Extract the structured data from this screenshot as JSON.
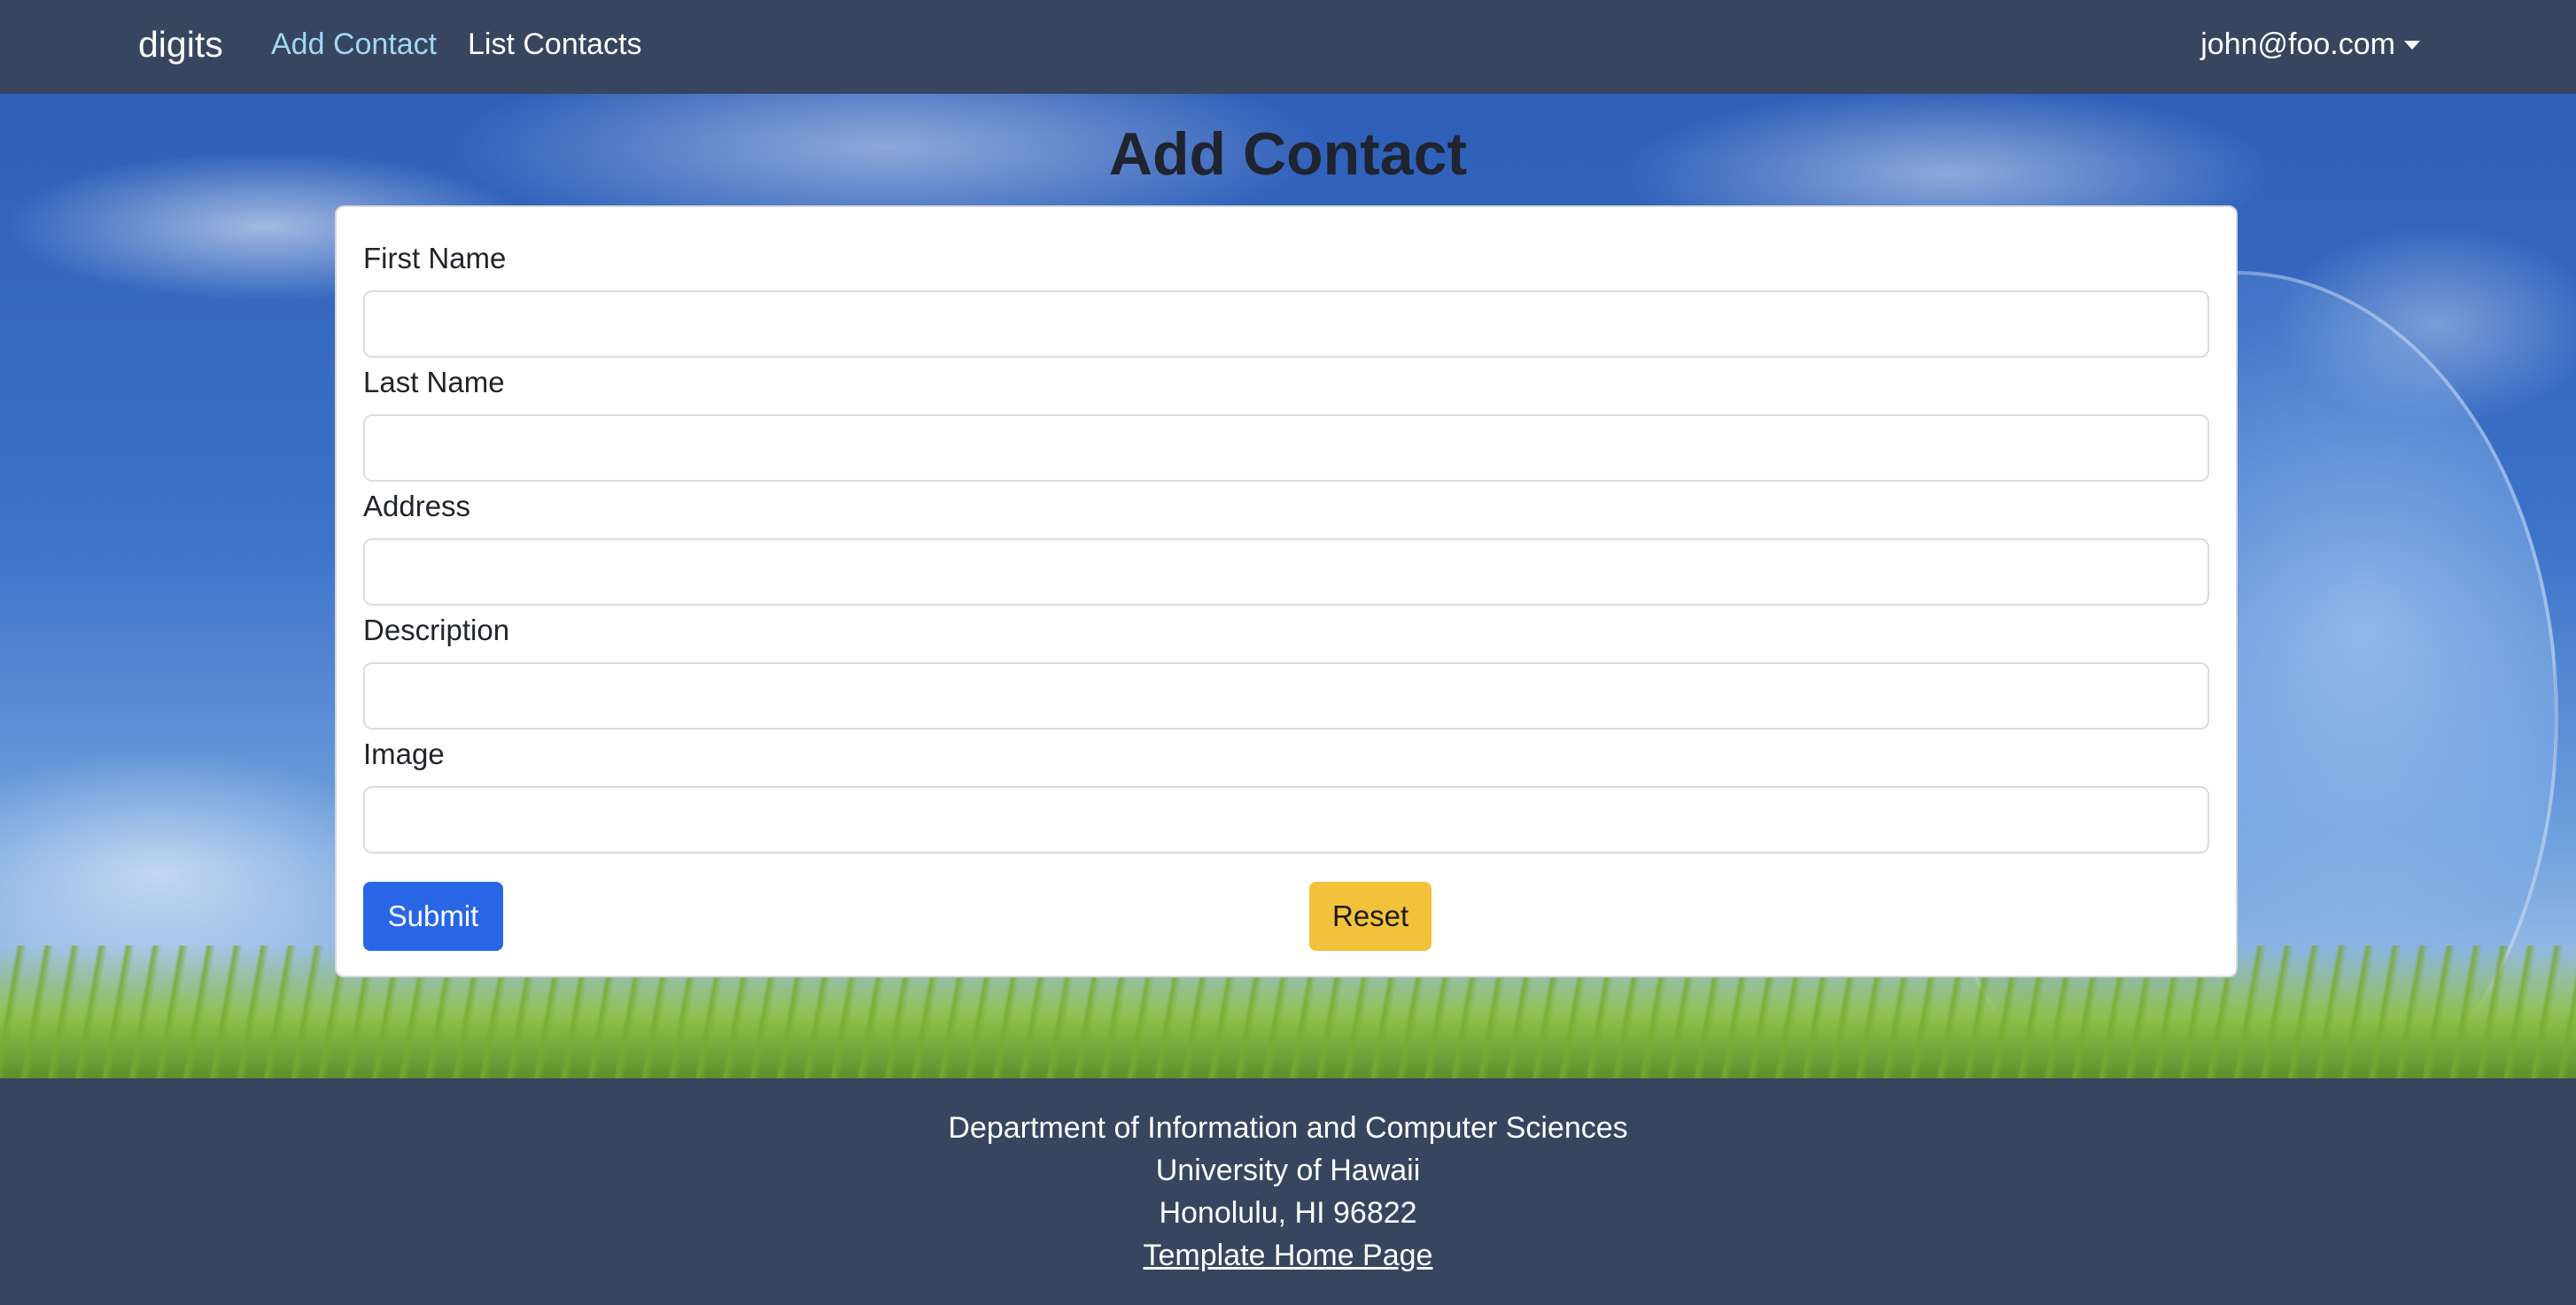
{
  "navbar": {
    "brand": "digits",
    "links": [
      {
        "label": "Add Contact",
        "active": true
      },
      {
        "label": "List Contacts",
        "active": false
      }
    ],
    "user": "john@foo.com"
  },
  "page": {
    "title": "Add Contact"
  },
  "form": {
    "fields": [
      {
        "label": "First Name",
        "value": "",
        "placeholder": ""
      },
      {
        "label": "Last Name",
        "value": "",
        "placeholder": ""
      },
      {
        "label": "Address",
        "value": "",
        "placeholder": ""
      },
      {
        "label": "Description",
        "value": "",
        "placeholder": ""
      },
      {
        "label": "Image",
        "value": "",
        "placeholder": ""
      }
    ],
    "submit_label": "Submit",
    "reset_label": "Reset"
  },
  "footer": {
    "lines": [
      "Department of Information and Computer Sciences",
      "University of Hawaii",
      "Honolulu, HI 96822"
    ],
    "link_label": "Template Home Page"
  },
  "colors": {
    "navbar": "#37455f",
    "active_link": "#9fd7f3",
    "submit": "#2866e6",
    "reset": "#f2c23a"
  }
}
